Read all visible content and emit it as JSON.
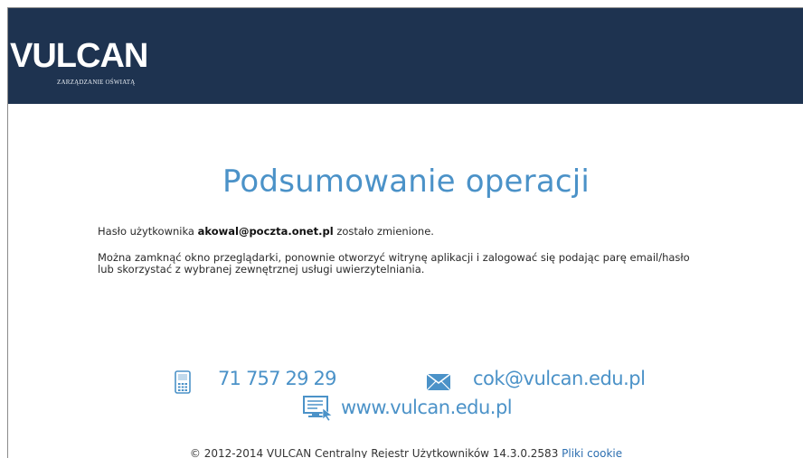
{
  "header": {
    "logo_text": "VULCAN",
    "logo_subtitle": "ZARZĄDZANIE OŚWIATĄ"
  },
  "main": {
    "title": "Podsumowanie operacji",
    "password_msg_prefix": "Hasło użytkownika",
    "user_email": "akowal@poczta.onet.pl",
    "password_msg_suffix": "zostało zmienione.",
    "info_line1": "Można zamknąć okno przeglądarki, ponownie otworzyć witrynę aplikacji i zalogować się podając parę email/hasło",
    "info_line2": "lub skorzystać z wybranej zewnętrznej usługi uwierzytelniania."
  },
  "contact": {
    "phone": "71 757 29 29",
    "email": "cok@vulcan.edu.pl",
    "website": "www.vulcan.edu.pl",
    "icons": {
      "phone": "phone-icon",
      "email": "envelope-icon",
      "website": "monitor-icon"
    }
  },
  "footer": {
    "copyright": "© 2012-2014 VULCAN Centralny Rejestr Użytkowników 14.3.0.2583",
    "cookies_link": "Pliki cookie"
  },
  "colors": {
    "header_bg": "#1e3350",
    "accent": "#4b92c8",
    "link": "#2d6fb0"
  }
}
